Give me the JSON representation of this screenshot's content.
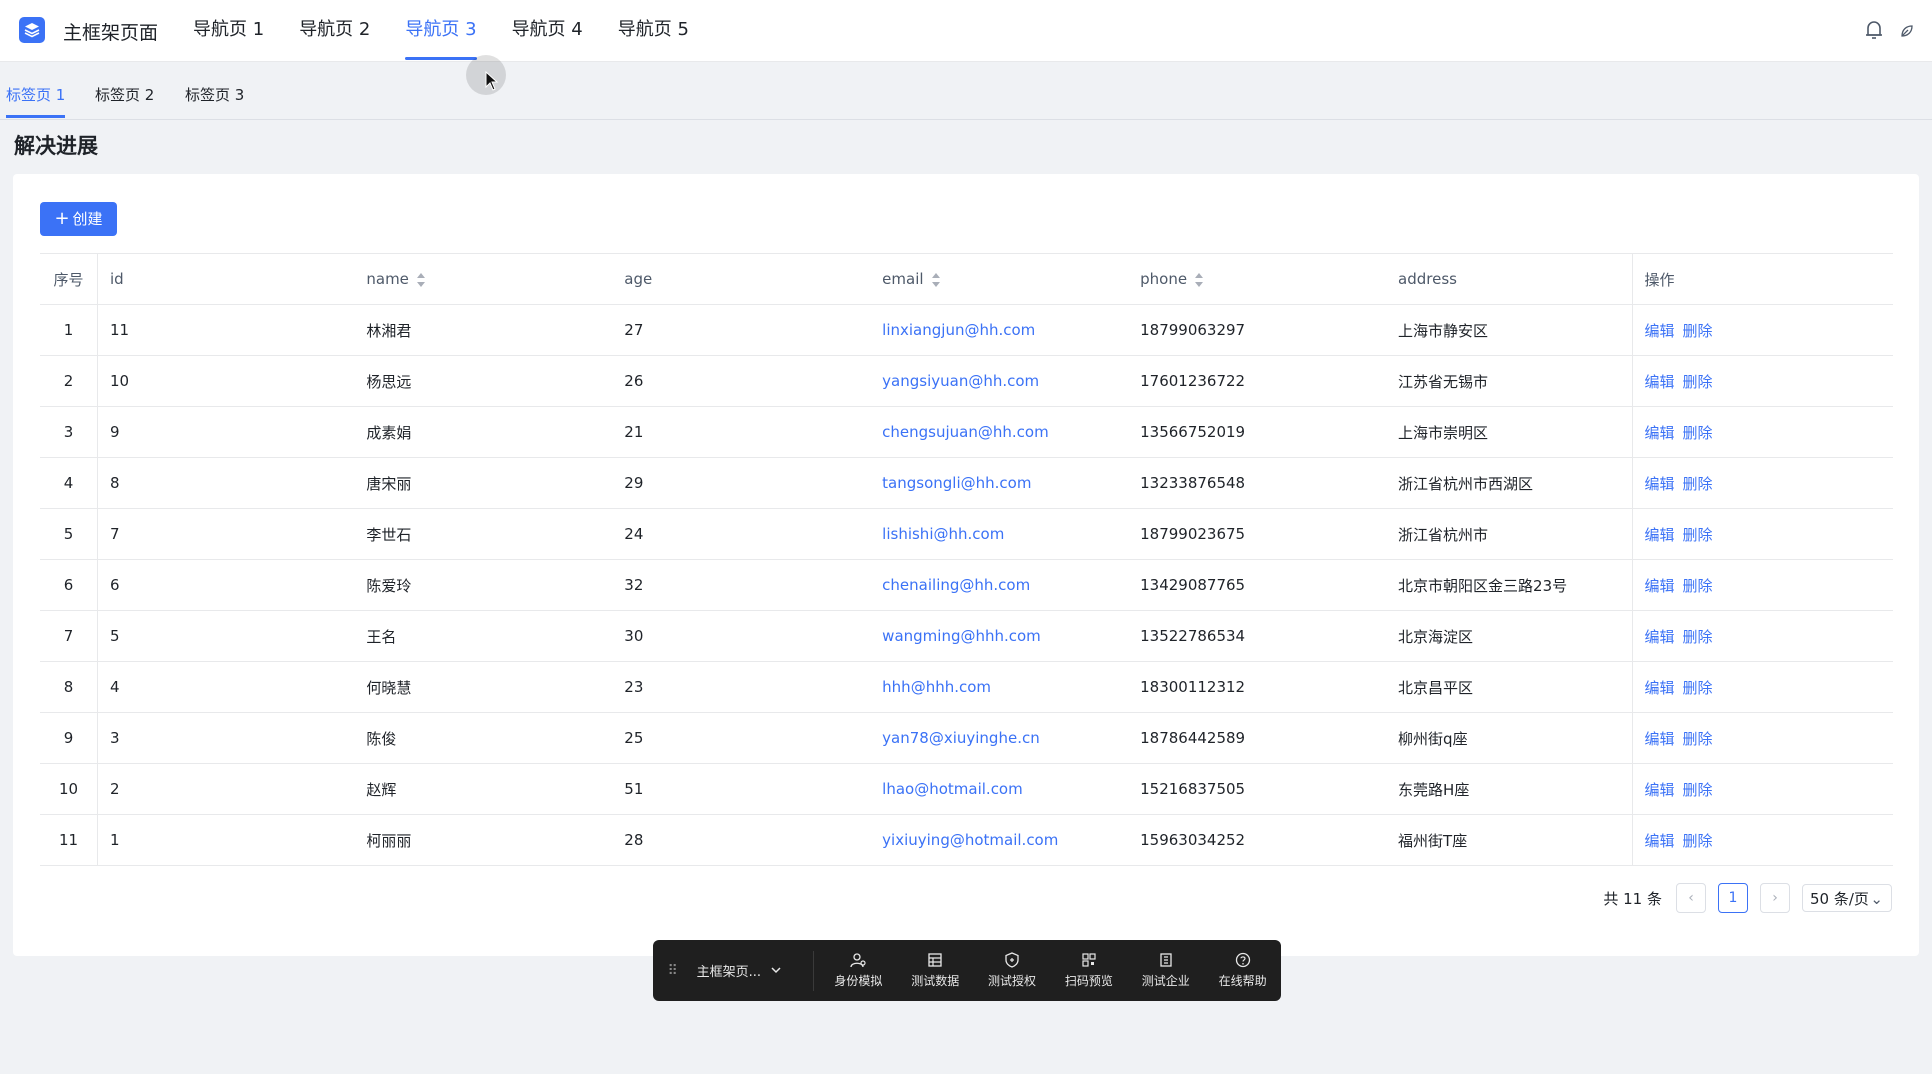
{
  "header": {
    "app_title": "主框架页面",
    "nav": [
      "导航页 1",
      "导航页 2",
      "导航页 3",
      "导航页 4",
      "导航页 5"
    ],
    "active_nav_index": 2,
    "icons": [
      "bell-icon",
      "leaf-icon"
    ]
  },
  "tabs": {
    "items": [
      "标签页 1",
      "标签页 2",
      "标签页 3"
    ],
    "active_index": 0
  },
  "page": {
    "title": "解决进展"
  },
  "toolbar_actions": {
    "create_label": "创建"
  },
  "table": {
    "columns": [
      "序号",
      "id",
      "name",
      "age",
      "email",
      "phone",
      "address",
      "操作"
    ],
    "sortable": [
      "name",
      "email",
      "phone"
    ],
    "rows": [
      {
        "seq": "1",
        "id": "11",
        "name": "林湘君",
        "age": "27",
        "email": "linxiangjun@hh.com",
        "phone": "18799063297",
        "address": "上海市静安区"
      },
      {
        "seq": "2",
        "id": "10",
        "name": "杨思远",
        "age": "26",
        "email": "yangsiyuan@hh.com",
        "phone": "17601236722",
        "address": "江苏省无锡市"
      },
      {
        "seq": "3",
        "id": "9",
        "name": "成素娟",
        "age": "21",
        "email": "chengsujuan@hh.com",
        "phone": "13566752019",
        "address": "上海市崇明区"
      },
      {
        "seq": "4",
        "id": "8",
        "name": "唐宋丽",
        "age": "29",
        "email": "tangsongli@hh.com",
        "phone": "13233876548",
        "address": "浙江省杭州市西湖区"
      },
      {
        "seq": "5",
        "id": "7",
        "name": "李世石",
        "age": "24",
        "email": "lishishi@hh.com",
        "phone": "18799023675",
        "address": "浙江省杭州市"
      },
      {
        "seq": "6",
        "id": "6",
        "name": "陈爱玲",
        "age": "32",
        "email": "chenailing@hh.com",
        "phone": "13429087765",
        "address": "北京市朝阳区金三路23号"
      },
      {
        "seq": "7",
        "id": "5",
        "name": "王名",
        "age": "30",
        "email": "wangming@hhh.com",
        "phone": "13522786534",
        "address": "北京海淀区"
      },
      {
        "seq": "8",
        "id": "4",
        "name": "何晓慧",
        "age": "23",
        "email": "hhh@hhh.com",
        "phone": "18300112312",
        "address": "北京昌平区"
      },
      {
        "seq": "9",
        "id": "3",
        "name": "陈俊",
        "age": "25",
        "email": "yan78@xiuyinghe.cn",
        "phone": "18786442589",
        "address": "柳州街q座"
      },
      {
        "seq": "10",
        "id": "2",
        "name": "赵辉",
        "age": "51",
        "email": "lhao@hotmail.com",
        "phone": "15216837505",
        "address": "东莞路H座"
      },
      {
        "seq": "11",
        "id": "1",
        "name": "柯丽丽",
        "age": "28",
        "email": "yixiuying@hotmail.com",
        "phone": "15963034252",
        "address": "福州街T座"
      }
    ],
    "row_actions": {
      "edit": "编辑",
      "delete": "删除"
    }
  },
  "pagination": {
    "total_text": "共 11 条",
    "current_page": "1",
    "page_size": "50 条/页"
  },
  "dev_toolbar": {
    "selector_label": "主框架页...",
    "items": [
      {
        "label": "身份模拟",
        "icon": "user-switch-icon"
      },
      {
        "label": "测试数据",
        "icon": "table-icon"
      },
      {
        "label": "测试授权",
        "icon": "shield-icon"
      },
      {
        "label": "扫码预览",
        "icon": "qrcode-icon"
      },
      {
        "label": "测试企业",
        "icon": "building-icon"
      },
      {
        "label": "在线帮助",
        "icon": "help-icon"
      }
    ]
  },
  "colors": {
    "primary": "#3b72f6",
    "toolbar_bg": "#1f1f1f",
    "page_bg": "#f0f2f5"
  }
}
